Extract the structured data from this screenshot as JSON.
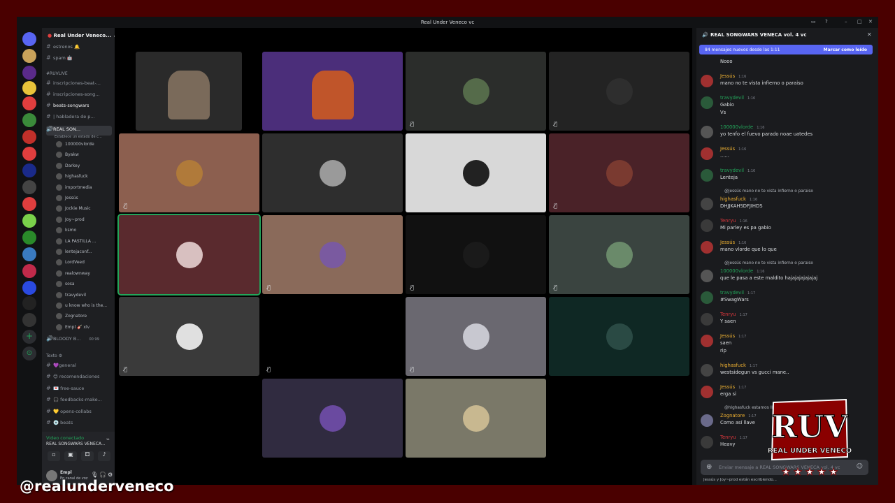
{
  "window": {
    "title": "Real Under Veneco vc"
  },
  "server": {
    "name": "Real Under Veneco..."
  },
  "channels": {
    "top": [
      {
        "label": "estrenos 🔔"
      },
      {
        "label": "spam 🤖"
      }
    ],
    "category_ruvlive": "#RUVLIVE",
    "ruvlive": [
      {
        "label": "inscripciones-beat-..."
      },
      {
        "label": "inscripciones-song..."
      },
      {
        "label": "beats-songwars"
      },
      {
        "label": "| habladera de p..."
      }
    ],
    "voice_active": {
      "label": "REAL SON...",
      "status": "Establece un estado de c..."
    },
    "voice_users": [
      "100000vlorde",
      "Byakw",
      "Darkey",
      "highasfuck",
      "importmedia",
      "Jessús",
      "Jockie Music",
      "Joy~prod",
      "ksmo",
      "LA PASTILLA ...",
      "lentejaconf...",
      "LordVeed",
      "realownway",
      "sosa",
      "travydevil",
      "u know who is the...",
      "Zognatore",
      "Empl 🎸 xlv"
    ],
    "bloody": {
      "label": "BLOODY B...",
      "count": "00 99"
    },
    "category_texto": "Texto ⚙",
    "texto": [
      {
        "label": "💜general"
      },
      {
        "label": "😊 recomendaciones"
      },
      {
        "label": "💌 free-sauce"
      },
      {
        "label": "🎧 feedbacks-make..."
      },
      {
        "label": "💛 opens-collabs"
      },
      {
        "label": "💿 beats"
      }
    ]
  },
  "voice": {
    "status": "Video conectado",
    "channel": "REAL SONGWARS VENECA..."
  },
  "user": {
    "name": "Empl",
    "status": "En canal de voz"
  },
  "chat": {
    "title": "REAL SONGWARS VENECA vol. 4 vc",
    "new_banner": "84 mensajes nuevos desde las 1:11",
    "mark_read": "Marcar como leído",
    "messages": [
      {
        "author": "",
        "time": "",
        "lines": [
          "Nooo"
        ],
        "color": "#f2f3f5"
      },
      {
        "author": "Jessús",
        "time": "1:16",
        "lines": [
          "mano no te vista infierno o paraiso"
        ],
        "color": "#f0b232"
      },
      {
        "author": "travydevil",
        "time": "1:16",
        "lines": [
          "Gabio",
          "Vs"
        ],
        "color": "#23a55a"
      },
      {
        "author": "100000vlorde",
        "time": "1:16",
        "lines": [
          "yo tenfo el fuevo parado noae uatedes"
        ],
        "color": "#23a55a"
      },
      {
        "author": "Jessús",
        "time": "1:16",
        "lines": [
          "......"
        ],
        "color": "#f0b232"
      },
      {
        "author": "travydevil",
        "time": "1:16",
        "lines": [
          "Lenteja"
        ],
        "color": "#23a55a"
      },
      {
        "reply": "@Jessús mano no te vista infierno o paraiso",
        "author": "highasfuck",
        "time": "1:16",
        "lines": [
          "DHJJKAHSDFJIHDS"
        ],
        "color": "#f0b232"
      },
      {
        "author": "Tenryu",
        "time": "1:16",
        "lines": [
          "Mi parley es pa gabio"
        ],
        "color": "#da373c"
      },
      {
        "author": "Jessús",
        "time": "1:16",
        "lines": [
          "mano vlorde que lo que"
        ],
        "color": "#f0b232"
      },
      {
        "reply": "@Jessús mano no te vista infierno o paraiso",
        "author": "100000vlorde",
        "time": "1:16",
        "lines": [
          "que le pasa a este maldito hajajajajajajaj"
        ],
        "color": "#23a55a"
      },
      {
        "author": "travydevil",
        "time": "1:17",
        "lines": [
          "#SwagWars"
        ],
        "color": "#23a55a"
      },
      {
        "author": "Tenryu",
        "time": "1:17",
        "lines": [
          "Y saen"
        ],
        "color": "#da373c"
      },
      {
        "author": "Jessús",
        "time": "1:17",
        "lines": [
          "saen",
          "rip"
        ],
        "color": "#f0b232"
      },
      {
        "author": "highasfuck",
        "time": "1:17",
        "lines": [
          "westsidegun vs gucci mane.."
        ],
        "color": "#f0b232"
      },
      {
        "author": "Jessús",
        "time": "1:17",
        "lines": [
          "erga si"
        ],
        "color": "#f0b232"
      },
      {
        "reply": "@highasfuck estamos llo...",
        "author": "Zognatore",
        "time": "1:17",
        "lines": [
          "Como así llave"
        ],
        "color": "#f0b232"
      },
      {
        "author": "Tenryu",
        "time": "1:17",
        "lines": [
          "Heavy"
        ],
        "color": "#da373c"
      }
    ],
    "input_placeholder": "Enviar mensaje a REAL SONGWARS VENECA vol. 4 vc",
    "typing": "Jessús y Joy~prod están escribiendo..."
  },
  "tiles": [
    {
      "bg": "#2a2a2a",
      "pic": "#7a6a5a",
      "muted": false,
      "cam": true
    },
    {
      "bg": "#4b2e7a",
      "pic": "#c0552a",
      "muted": false,
      "cam": true
    },
    {
      "bg": "#2b2d2b",
      "pic": "#556b4a",
      "muted": true
    },
    {
      "bg": "#232323",
      "pic": "#2e2e2e",
      "muted": true
    },
    {
      "bg": "#8c5f4f",
      "pic": "#b07a3a",
      "muted": true
    },
    {
      "bg": "#2e2e2e",
      "pic": "#9a9a9a",
      "muted": false
    },
    {
      "bg": "#d8d8d8",
      "pic": "#222222",
      "muted": false
    },
    {
      "bg": "#4a2228",
      "pic": "#7a3a30",
      "muted": true
    },
    {
      "bg": "#5a2a2e",
      "pic": "#d8c0c0",
      "muted": false,
      "active": true
    },
    {
      "bg": "#8a6a5a",
      "pic": "#7a5aa0",
      "muted": true
    },
    {
      "bg": "#111111",
      "pic": "#1a1a1a",
      "muted": true
    },
    {
      "bg": "#3a4440",
      "pic": "#6a8a6a",
      "muted": true
    },
    {
      "bg": "#3a3a3a",
      "pic": "#e0e0e0",
      "muted": true
    },
    {
      "bg": "#000000",
      "pic": "#000000",
      "muted": true,
      "empty": true
    },
    {
      "bg": "#6a6870",
      "pic": "#c8c8d0",
      "muted": true
    },
    {
      "bg": "#0f2824",
      "pic": "#2a4a44",
      "muted": false
    },
    {
      "bg": "#302b40",
      "pic": "#6a4aa0",
      "muted": false
    },
    {
      "bg": "#7a7868",
      "pic": "#c8b890",
      "muted": false
    }
  ],
  "overlay": {
    "handle": "@realunderveneco",
    "logo_top": "RUV",
    "logo_bottom": "REAL UNDER VENECO"
  },
  "colors": {
    "accent": "#5865f2",
    "frame": "#4a0000"
  }
}
